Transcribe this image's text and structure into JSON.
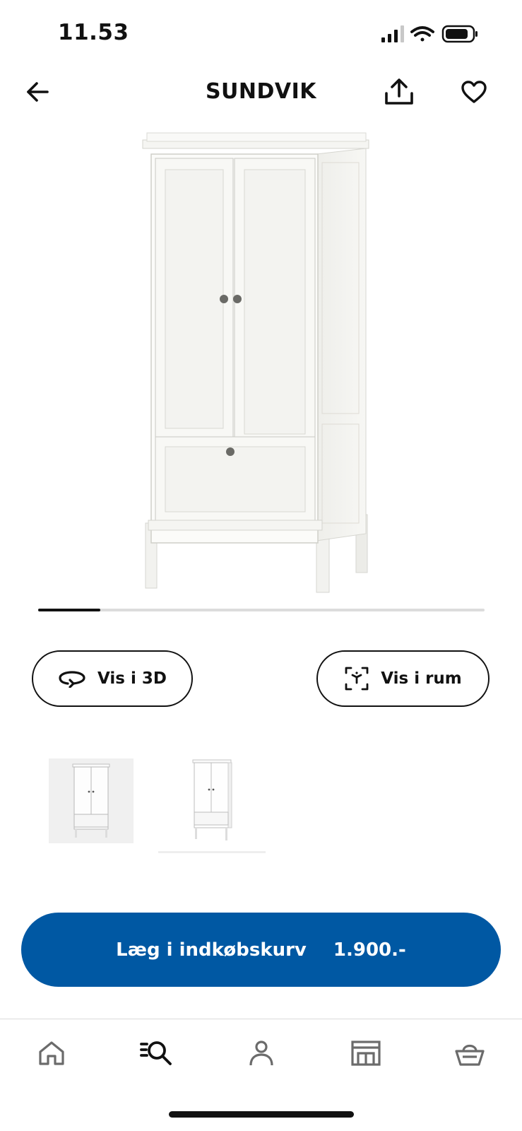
{
  "status": {
    "time": "11.53"
  },
  "header": {
    "title": "SUNDVIK"
  },
  "carousel": {
    "progress": 0.14
  },
  "buttons": {
    "view_3d": "Vis i 3D",
    "view_in_room": "Vis i rum"
  },
  "cta": {
    "label": "Læg i indkøbskurv",
    "price": "1.900.-"
  },
  "colors": {
    "brand_blue": "#0058a3",
    "text": "#111111"
  },
  "tabs": [
    "home-icon",
    "search-icon",
    "profile-icon",
    "store-icon",
    "basket-icon"
  ]
}
